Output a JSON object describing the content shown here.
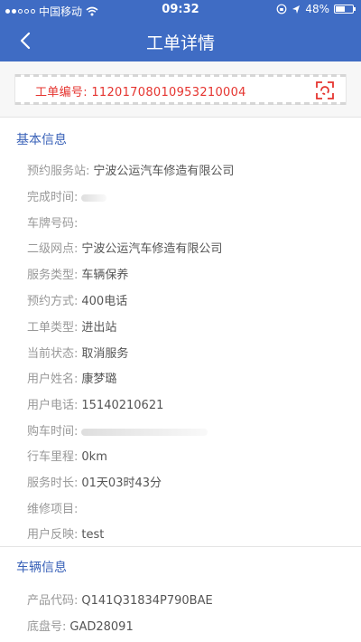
{
  "status_bar": {
    "carrier": "中国移动",
    "time": "09:32",
    "battery": "48%"
  },
  "nav": {
    "title": "工单详情"
  },
  "order": {
    "label": "工单编号:",
    "number": "1120170801095321​0004"
  },
  "basic": {
    "title": "基本信息",
    "rows": [
      {
        "label": "预约服务站:",
        "value": "宁波公运汽车修造有限公司"
      },
      {
        "label": "完成时间:",
        "value": ""
      },
      {
        "label": "车牌号码:",
        "value": ""
      },
      {
        "label": "二级网点:",
        "value": "宁波公运汽车修造有限公司"
      },
      {
        "label": "服务类型:",
        "value": "车辆保养"
      },
      {
        "label": "预约方式:",
        "value": "400电话"
      },
      {
        "label": "工单类型:",
        "value": "进出站"
      },
      {
        "label": "当前状态:",
        "value": "取消服务"
      },
      {
        "label": "用户姓名:",
        "value": "康梦璐"
      },
      {
        "label": "用户电话:",
        "value": "15140210621"
      },
      {
        "label": "购车时间:",
        "value": ""
      },
      {
        "label": "行车里程:",
        "value": "0km"
      },
      {
        "label": "服务时长:",
        "value": "01天03时43分"
      },
      {
        "label": "维修项目:",
        "value": ""
      },
      {
        "label": "用户反映:",
        "value": "test"
      }
    ]
  },
  "vehicle": {
    "title": "车辆信息",
    "rows": [
      {
        "label": "产品代码:",
        "value": "Q141Q31834P790BAE"
      },
      {
        "label": "底盘号:",
        "value": "GAD28091"
      }
    ]
  },
  "colors": {
    "accent": "#3f6cc4",
    "order_red": "#e5342f",
    "section_blue": "#3a62b8"
  }
}
